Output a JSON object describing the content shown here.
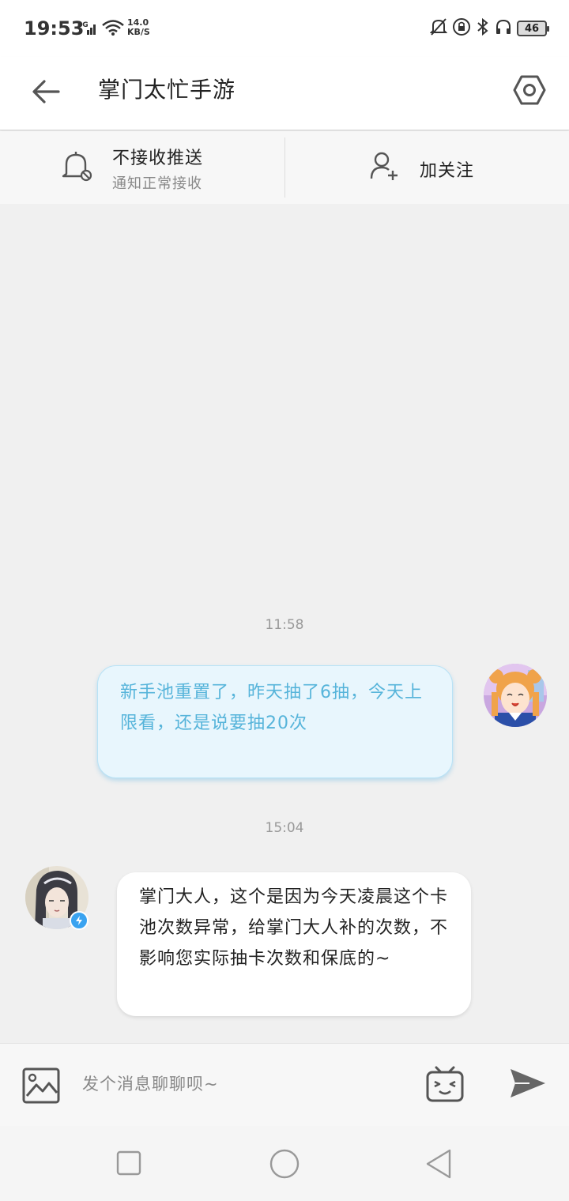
{
  "status_bar": {
    "time": "19:53",
    "network": "4G",
    "speed_value": "14.0",
    "speed_unit": "KB/S",
    "battery": "46"
  },
  "header": {
    "title": "掌门太忙手游"
  },
  "actions": {
    "push_title": "不接收推送",
    "push_subtitle": "通知正常接收",
    "follow_label": "加关注"
  },
  "messages": [
    {
      "timestamp": "11:58",
      "sender": "me",
      "text": "新手池重置了，昨天抽了6抽，今天上限看，还是说要抽20次"
    },
    {
      "timestamp": "15:04",
      "sender": "them",
      "text": "掌门大人，这个是因为今天凌晨这个卡池次数异常，给掌门大人补的次数，不影响您实际抽卡次数和保底的~"
    }
  ],
  "input": {
    "placeholder": "发个消息聊聊呗~"
  },
  "icons": {
    "back": "back-arrow-icon",
    "settings": "hexagon-settings-icon",
    "bell": "bell-muted-icon",
    "follow": "add-user-icon",
    "image": "image-icon",
    "emoji": "tv-face-emoji-icon",
    "send": "send-icon"
  },
  "colors": {
    "my_bubble_bg": "#e8f6fd",
    "my_bubble_text": "#56b4da",
    "verified_badge": "#3aa3f0"
  }
}
